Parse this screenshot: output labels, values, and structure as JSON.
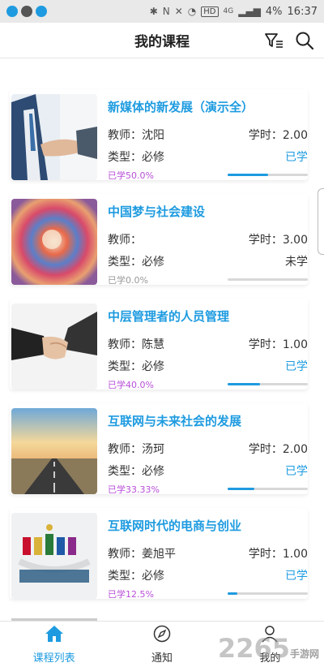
{
  "status_bar": {
    "hd": "HD",
    "network": "4G",
    "battery": "4%",
    "time": "16:37"
  },
  "header": {
    "title": "我的课程"
  },
  "courses": [
    {
      "title": "新媒体的新发展（演示全）",
      "teacher": "教师：沈阳",
      "hours": "学时：2.00",
      "type": "类型：必修",
      "status": "已学",
      "status_kind": "learned",
      "progress_label": "已学50.0%",
      "progress": 0.5,
      "progress_color": "#b84fd8"
    },
    {
      "title": "中国梦与社会建设",
      "teacher": "教师：",
      "hours": "学时：3.00",
      "type": "类型：必修",
      "status": "未学",
      "status_kind": "unlearned",
      "progress_label": "已学0.0%",
      "progress": 0.0,
      "progress_color": "#999999"
    },
    {
      "title": "中层管理者的人员管理",
      "teacher": "教师：陈慧",
      "hours": "学时：1.00",
      "type": "类型：必修",
      "status": "已学",
      "status_kind": "learned",
      "progress_label": "已学40.0%",
      "progress": 0.4,
      "progress_color": "#b84fd8"
    },
    {
      "title": "互联网与未来社会的发展",
      "teacher": "教师：汤珂",
      "hours": "学时：2.00",
      "type": "类型：必修",
      "status": "已学",
      "status_kind": "learned",
      "progress_label": "已学33.33%",
      "progress": 0.3333,
      "progress_color": "#b84fd8"
    },
    {
      "title": "互联网时代的电商与创业",
      "teacher": "教师：姜旭平",
      "hours": "学时：1.00",
      "type": "类型：必修",
      "status": "已学",
      "status_kind": "learned",
      "progress_label": "已学12.5%",
      "progress": 0.125,
      "progress_color": "#b84fd8"
    }
  ],
  "tabs": [
    {
      "label": "课程列表",
      "icon": "home-icon",
      "active": true
    },
    {
      "label": "通知",
      "icon": "compass-icon",
      "active": false
    },
    {
      "label": "我的",
      "icon": "user-icon",
      "active": false
    }
  ],
  "watermark": {
    "main": "2265",
    "sub": "手游网"
  },
  "colors": {
    "accent": "#1e9be0",
    "progress_text": "#b84fd8"
  }
}
